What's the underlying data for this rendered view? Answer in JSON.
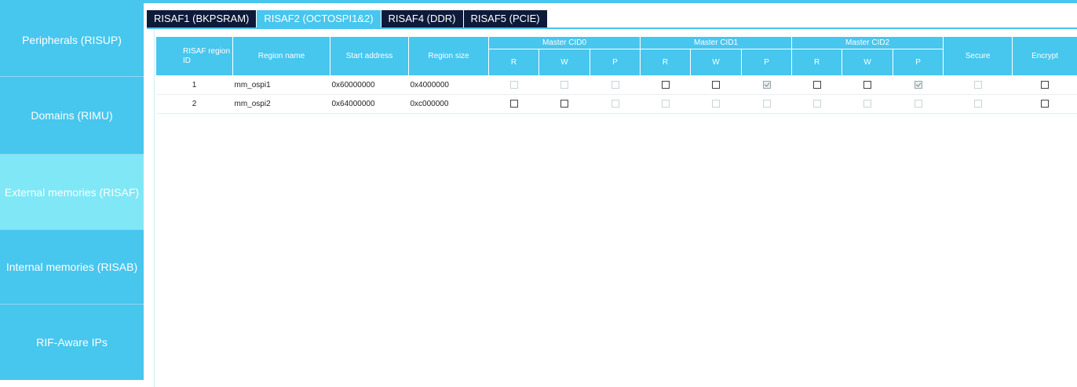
{
  "colors": {
    "accent": "#47c6ee",
    "accent_active": "#7fe7f6",
    "tab_dark": "#0d1a3a"
  },
  "sidebar": {
    "items": [
      {
        "label": "Peripherals (RISUP)",
        "active": false
      },
      {
        "label": "Domains (RIMU)",
        "active": false
      },
      {
        "label": "External memories (RISAF)",
        "active": true
      },
      {
        "label": "Internal memories (RISAB)",
        "active": false
      },
      {
        "label": "RIF-Aware IPs",
        "active": false
      }
    ]
  },
  "tabs": [
    {
      "label": "RISAF1 (BKPSRAM)",
      "active": false
    },
    {
      "label": "RISAF2 (OCTOSPI1&2)",
      "active": true
    },
    {
      "label": "RISAF4 (DDR)",
      "active": false
    },
    {
      "label": "RISAF5 (PCIE)",
      "active": false
    }
  ],
  "table": {
    "headers": {
      "region_id": "RISAF region ID",
      "region_name": "Region name",
      "start_address": "Start address",
      "region_size": "Region size",
      "master_cid0": "Master CID0",
      "master_cid1": "Master CID1",
      "master_cid2": "Master CID2",
      "r": "R",
      "w": "W",
      "p": "P",
      "secure": "Secure",
      "encrypt": "Encrypt"
    },
    "rows": [
      {
        "id": "1",
        "name": "mm_ospi1",
        "start": "0x60000000",
        "size": "0x4000000",
        "cid0": [
          "disabled",
          "disabled",
          "disabled"
        ],
        "cid1": [
          "unchecked",
          "unchecked",
          "checked"
        ],
        "cid2": [
          "unchecked",
          "unchecked",
          "checked"
        ],
        "secure": "disabled",
        "encrypt": "unchecked"
      },
      {
        "id": "2",
        "name": "mm_ospi2",
        "start": "0x64000000",
        "size": "0xc000000",
        "cid0": [
          "unchecked",
          "unchecked",
          "disabled"
        ],
        "cid1": [
          "disabled",
          "disabled",
          "disabled"
        ],
        "cid2": [
          "disabled",
          "disabled",
          "disabled"
        ],
        "secure": "disabled",
        "encrypt": "unchecked"
      }
    ]
  }
}
